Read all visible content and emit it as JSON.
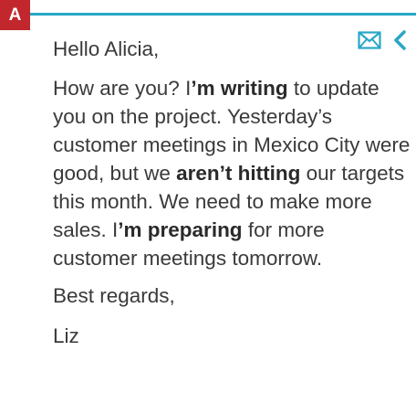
{
  "badge": "A",
  "icons": {
    "email": "envelope-icon",
    "back": "chevron-left-icon",
    "accent_color": "#29a7c7",
    "badge_color": "#c2272d"
  },
  "email": {
    "greeting": "Hello Alicia,",
    "segments": [
      {
        "text": "How are you? I",
        "bold": false
      },
      {
        "text": "’m writing",
        "bold": true
      },
      {
        "text": " to update you on the project. Yesterday’s customer meetings in Mexico City were good, but we ",
        "bold": false
      },
      {
        "text": "aren’t hitting",
        "bold": true
      },
      {
        "text": " our targets this month. We need to make more sales. I",
        "bold": false
      },
      {
        "text": "’m preparing",
        "bold": true
      },
      {
        "text": " for more customer meetings tomorrow.",
        "bold": false
      }
    ],
    "closing": "Best regards,",
    "signature": "Liz"
  }
}
